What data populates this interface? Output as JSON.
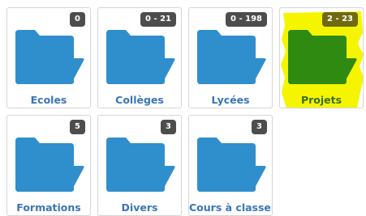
{
  "highlight_color": "#f5f500",
  "folder_color": "#2f8fcd",
  "folder_color_highlighted": "#2e8a10",
  "label_color": "#3a75b6",
  "badge_color": "#4d4d4d",
  "tiles": [
    {
      "label": "Ecoles",
      "badge": "0",
      "icon": "folder-icon",
      "highlighted": false
    },
    {
      "label": "Collèges",
      "badge": "0 - 21",
      "icon": "folder-icon",
      "highlighted": false
    },
    {
      "label": "Lycées",
      "badge": "0 - 198",
      "icon": "folder-icon",
      "highlighted": false
    },
    {
      "label": "Projets",
      "badge": "2 - 23",
      "icon": "folder-icon",
      "highlighted": true
    },
    {
      "label": "Formations",
      "badge": "5",
      "icon": "folder-icon",
      "highlighted": false
    },
    {
      "label": "Divers",
      "badge": "3",
      "icon": "folder-icon",
      "highlighted": false
    },
    {
      "label": "Cours à classer",
      "badge": "3",
      "icon": "folder-icon",
      "highlighted": false
    }
  ]
}
